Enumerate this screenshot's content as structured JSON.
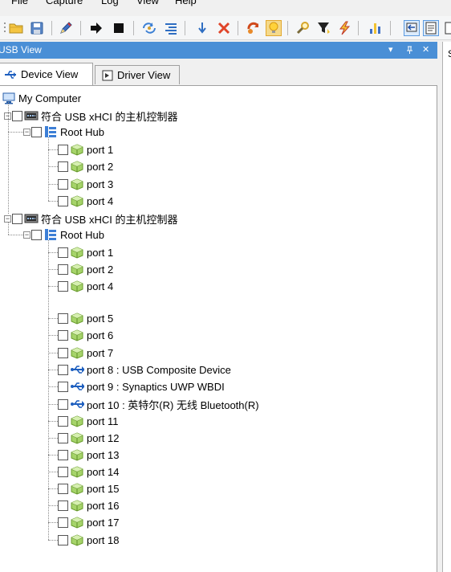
{
  "menu": [
    "File",
    "Capture",
    "Log",
    "View",
    "Help"
  ],
  "panel": {
    "title": "USB View",
    "dropdown_glyph": "▾",
    "pin_glyph": "ᵖ",
    "close_glyph": "✕"
  },
  "tabs": [
    {
      "label": "Device View",
      "icon": "usb-icon",
      "active": true
    },
    {
      "label": "Driver View",
      "icon": "driver-icon",
      "active": false
    }
  ],
  "right_pane_label": "S",
  "tree": {
    "root": "My Computer",
    "controllers": [
      {
        "label": "符合 USB xHCI 的主机控制器",
        "hub": "Root Hub",
        "ports": [
          {
            "label": "port 1",
            "type": "empty"
          },
          {
            "label": "port 2",
            "type": "empty"
          },
          {
            "label": "port 3",
            "type": "empty"
          },
          {
            "label": "port 4",
            "type": "empty"
          }
        ]
      },
      {
        "label": "符合 USB xHCI 的主机控制器",
        "hub": "Root Hub",
        "ports": [
          {
            "label": "port 1",
            "type": "empty"
          },
          {
            "label": "port 2",
            "type": "empty"
          },
          {
            "label": "port 4",
            "type": "empty"
          },
          {
            "label": "port 5",
            "type": "empty"
          },
          {
            "label": "port 6",
            "type": "empty"
          },
          {
            "label": "port 7",
            "type": "empty"
          },
          {
            "label": "port 8 : USB Composite Device",
            "type": "device"
          },
          {
            "label": "port 9 : Synaptics UWP WBDI",
            "type": "device"
          },
          {
            "label": "port 10 : 英特尔(R) 无线 Bluetooth(R)",
            "type": "device"
          },
          {
            "label": "port 11",
            "type": "empty"
          },
          {
            "label": "port 12",
            "type": "empty"
          },
          {
            "label": "port 13",
            "type": "empty"
          },
          {
            "label": "port 14",
            "type": "empty"
          },
          {
            "label": "port 15",
            "type": "empty"
          },
          {
            "label": "port 16",
            "type": "empty"
          },
          {
            "label": "port 17",
            "type": "empty"
          },
          {
            "label": "port 18",
            "type": "empty"
          }
        ]
      }
    ]
  }
}
